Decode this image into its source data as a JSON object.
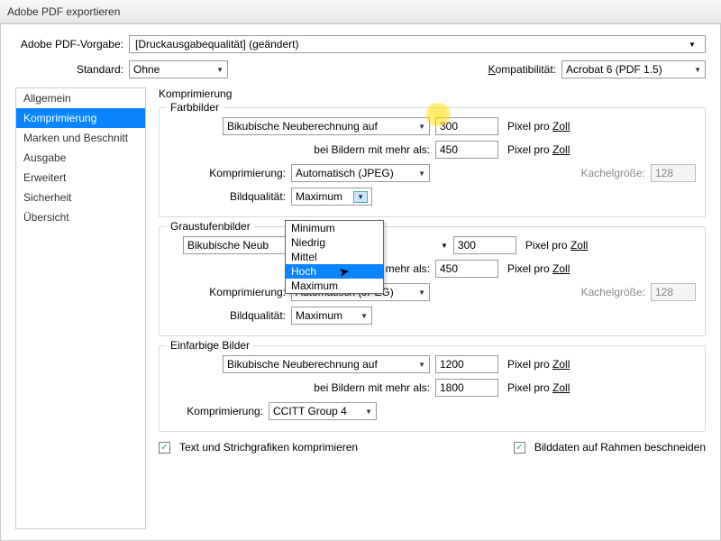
{
  "title": "Adobe PDF exportieren",
  "header": {
    "preset_label": "Adobe PDF-Vorgabe:",
    "preset_value": "[Druckausgabequalität] (geändert)",
    "standard_label": "Standard:",
    "standard_value": "Ohne",
    "compat_label": "Kompatibilität:",
    "compat_value": "Acrobat 6 (PDF 1.5)"
  },
  "sidebar": {
    "items": [
      {
        "label": "Allgemein"
      },
      {
        "label": "Komprimierung"
      },
      {
        "label": "Marken und Beschnitt"
      },
      {
        "label": "Ausgabe"
      },
      {
        "label": "Erweitert"
      },
      {
        "label": "Sicherheit"
      },
      {
        "label": "Übersicht"
      }
    ]
  },
  "main": {
    "heading": "Komprimierung",
    "group_color": {
      "title": "Farbbilder",
      "resample_method": "Bikubische Neuberechnung auf",
      "resample_value": "300",
      "ppi_label_pre": "Pixel pro ",
      "ppi_label_zoll": "Zoll",
      "threshold_label": "bei Bildern mit mehr als:",
      "threshold_value": "450",
      "compress_label": "Komprimierung:",
      "compress_value": "Automatisch (JPEG)",
      "tile_label": "Kachelgröße:",
      "tile_value": "128",
      "quality_label": "Bildqualität:",
      "quality_value": "Maximum",
      "quality_options": [
        "Minimum",
        "Niedrig",
        "Mittel",
        "Hoch",
        "Maximum"
      ],
      "quality_hover": "Hoch"
    },
    "group_gray": {
      "title": "Graustufenbilder",
      "resample_method": "Bikubische Neuberechnung auf",
      "resample_method_cut": "Bikubische Neub",
      "resample_value": "300",
      "threshold_label_cut": "mit mehr als:",
      "threshold_value": "450",
      "compress_label": "Komprimierung:",
      "compress_value": "Automatisch (JPEG)",
      "tile_label": "Kachelgröße:",
      "tile_value": "128",
      "quality_label": "Bildqualität:",
      "quality_value": "Maximum"
    },
    "group_mono": {
      "title": "Einfarbige Bilder",
      "resample_method": "Bikubische Neuberechnung auf",
      "resample_value": "1200",
      "threshold_label": "bei Bildern mit mehr als:",
      "threshold_value": "1800",
      "compress_label": "Komprimierung:",
      "compress_value": "CCITT Group 4"
    },
    "footer": {
      "cb_text_label": "Text und Strichgrafiken komprimieren",
      "cb_crop_label": "Bilddaten auf Rahmen beschneiden"
    }
  }
}
